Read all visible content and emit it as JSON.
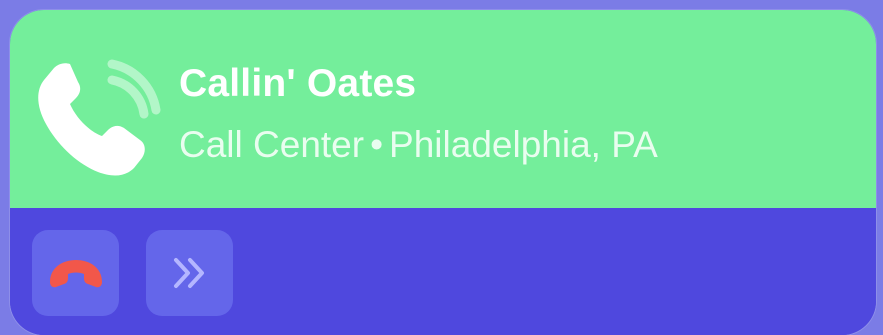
{
  "call": {
    "name": "Callin' Oates",
    "subtitle": {
      "category": "Call Center",
      "separator": "•",
      "location": "Philadelphia, PA"
    }
  },
  "actions": [
    {
      "icon": "hang-up-icon",
      "color": "#f2574a"
    },
    {
      "icon": "double-chevron-right-icon",
      "color": "#b4b6ff"
    }
  ],
  "colors": {
    "header_bg": "#74ee9b",
    "footer_bg": "#4f48de",
    "button_bg": "#6466ea",
    "page_bg": "#7b7ce6"
  }
}
